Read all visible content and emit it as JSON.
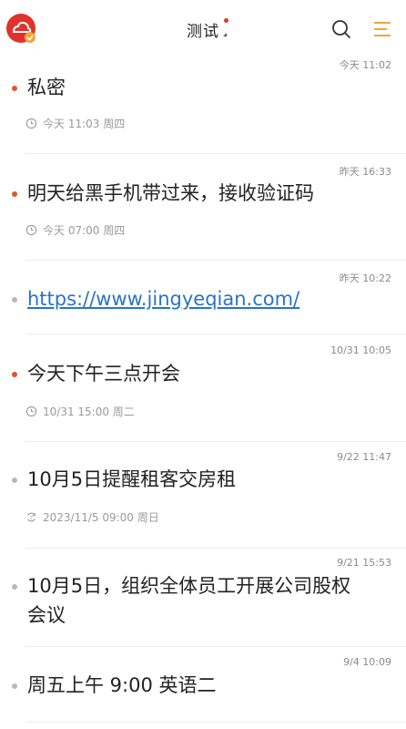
{
  "header": {
    "title": "测试"
  },
  "notes": [
    {
      "time": "今天 11:02",
      "text": "私密",
      "bullet": "red",
      "reminder": "今天 11:03 周四",
      "reminder_icon": "clock-icon"
    },
    {
      "time": "昨天 16:33",
      "text": "明天给黑手机带过来，接收验证码",
      "bullet": "red",
      "reminder": "今天 07:00 周四",
      "reminder_icon": "clock-icon"
    },
    {
      "time": "昨天 10:22",
      "text": "https://www.jingyeqian.com/",
      "bullet": "gray"
    },
    {
      "time": "10/31 10:05",
      "text": "今天下午三点开会",
      "bullet": "red",
      "reminder": "10/31 15:00 周二",
      "reminder_icon": "clock-icon"
    },
    {
      "time": "9/22 11:47",
      "text": "10月5日提醒租客交房租",
      "bullet": "gray",
      "reminder": "2023/11/5 09:00 周日",
      "reminder_icon": "repeat-icon"
    },
    {
      "time": "9/21 15:53",
      "text_line1": "10月5日，组织全体员工开展公司股权",
      "text_line2": "会议",
      "bullet": "gray"
    },
    {
      "time": "9/4 10:09",
      "text": "周五上午 9:00  英语二",
      "bullet": "gray"
    }
  ]
}
